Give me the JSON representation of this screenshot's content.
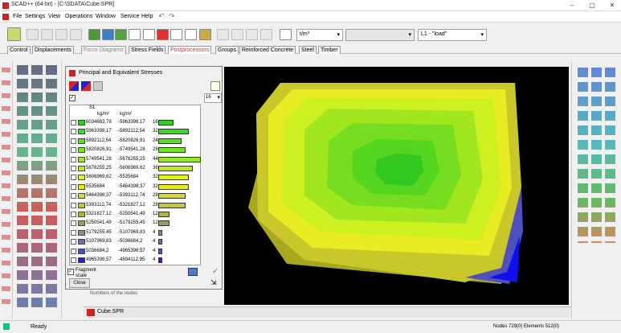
{
  "app": {
    "title": "SCAD++ (64-bit) - [C:\\SDATA\\Cube.SPR]",
    "window_controls": [
      "–",
      "▢",
      "✕"
    ]
  },
  "menu": [
    "File",
    "Settings",
    "View",
    "Operations",
    "Window",
    "Service",
    "Help"
  ],
  "toolbar": {
    "units_combo": "t/m³",
    "empty_combo": "",
    "load_combo": "L1 - \"load\""
  },
  "tabs": [
    "Control",
    "Displacements",
    "Force Diagrams",
    "Stress Fields",
    "Postprocessors",
    "Groups",
    "Reinforced Concrete",
    "Steel",
    "Timber"
  ],
  "dialog": {
    "title": "Principal and Equivalent Stresses",
    "scale_count": "16",
    "column_group": "S1",
    "col_headers": [
      "kg/m²",
      "kg/m²"
    ],
    "rows": [
      {
        "from": "6034683,79",
        "to": "-5963398,17",
        "pct": "16",
        "color": "#33cc22"
      },
      {
        "from": "5963398,17",
        "to": "-5892112,54",
        "pct": "32",
        "color": "#33dd22"
      },
      {
        "from": "5892112,54",
        "to": "-5820826,91",
        "pct": "24",
        "color": "#55e020"
      },
      {
        "from": "5820826,91",
        "to": "-5749541,28",
        "pct": "28",
        "color": "#77e420"
      },
      {
        "from": "5749541,28",
        "to": "-5678255,25",
        "pct": "44",
        "color": "#99e820"
      },
      {
        "from": "5678255,25",
        "to": "-5606969,62",
        "pct": "36",
        "color": "#bbec22"
      },
      {
        "from": "5606969,62",
        "to": "-5535684",
        "pct": "32",
        "color": "#ddf022"
      },
      {
        "from": "5535684",
        "to": "-5464398,37",
        "pct": "32",
        "color": "#eaea22"
      },
      {
        "from": "5464398,37",
        "to": "-5393112,74",
        "pct": "28",
        "color": "#d8d830"
      },
      {
        "from": "5393112,74",
        "to": "-5321827,12",
        "pct": "28",
        "color": "#c4c438"
      },
      {
        "from": "5321827,12",
        "to": "-5250541,49",
        "pct": "12",
        "color": "#b0b048"
      },
      {
        "from": "5250541,49",
        "to": "-5179255,45",
        "pct": "12",
        "color": "#9c9c5a"
      },
      {
        "from": "5179255,45",
        "to": "-5107969,83",
        "pct": "4",
        "color": "#8a8a80"
      },
      {
        "from": "5107969,83",
        "to": "-5036684,2",
        "pct": "4",
        "color": "#7070a0"
      },
      {
        "from": "5036684,2",
        "to": "-4965398,57",
        "pct": "4",
        "color": "#5050c0"
      },
      {
        "from": "4965398,57",
        "to": "-4894112,95",
        "pct": "4",
        "color": "#2020e0"
      }
    ],
    "fragment_label": "Fragment scale",
    "close_label": "Close"
  },
  "viewport_caption": "Numbers of the nodes",
  "doc_tab": "Cube.SPR",
  "status": {
    "left": "Ready",
    "right": "Nodes 729(0) Elements 512(0)"
  }
}
